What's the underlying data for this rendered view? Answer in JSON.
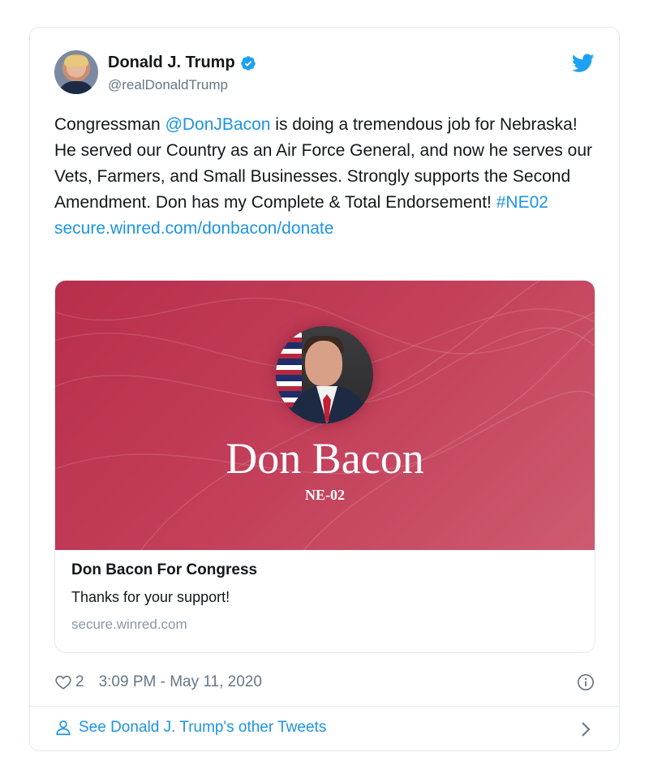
{
  "tweet": {
    "author_name": "Donald J. Trump",
    "author_handle": "@realDonaldTrump",
    "text": {
      "line1_pre": "Congressman ",
      "mention": "@DonJBacon",
      "line1_post": " is doing a tremendous job for Nebraska! He served our Country as an Air Force General, and now he serves our Vets, Farmers, and Small Businesses. Strongly supports the Second Amendment. Don has my Complete & Total Endorsement! ",
      "hashtag": "#NE02",
      "url": "secure.winred.com/donbacon/donate"
    },
    "likes": "2",
    "timestamp": "3:09 PM - May 11, 2020"
  },
  "link_card": {
    "hero_title": "Don Bacon",
    "hero_subtitle": "NE-02",
    "title": "Don Bacon For Congress",
    "description": "Thanks for your support!",
    "domain": "secure.winred.com"
  },
  "footer": {
    "label": "See Donald J. Trump's other Tweets"
  },
  "icons": {
    "verified": "verified-badge-icon",
    "brand": "twitter-bird-icon",
    "like": "heart-icon",
    "info": "info-icon",
    "profile": "person-icon",
    "more": "chevron-right-icon"
  },
  "colors": {
    "link": "#1b95e0",
    "secondary_text": "#657786",
    "hero_background": "#c33f5a",
    "border": "#e1e8ed"
  }
}
